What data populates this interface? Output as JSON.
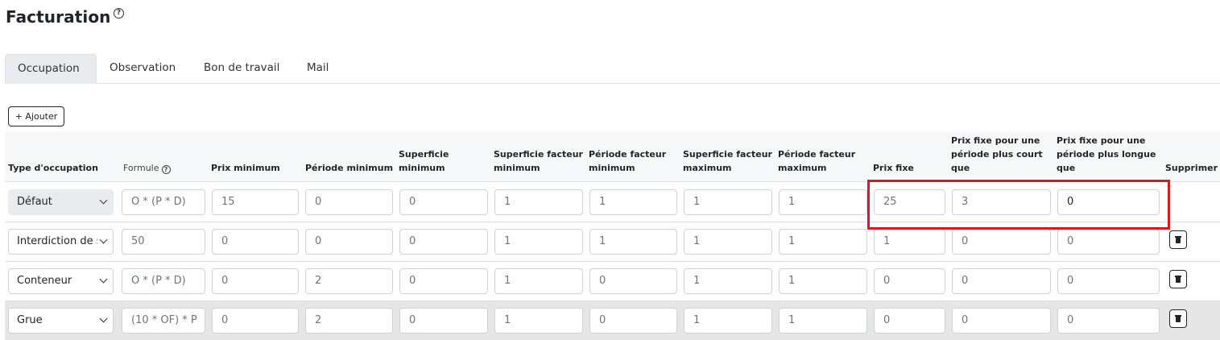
{
  "page": {
    "title": "Facturation",
    "help_glyph": "?"
  },
  "tabs": [
    {
      "label": "Occupation",
      "active": true
    },
    {
      "label": "Observation",
      "active": false
    },
    {
      "label": "Bon de travail",
      "active": false
    },
    {
      "label": "Mail",
      "active": false
    }
  ],
  "toolbar": {
    "add_label": "+ Ajouter"
  },
  "table": {
    "headers": {
      "type": "Type d'occupation",
      "formule": "Formule",
      "prix_min": "Prix minimum",
      "periode_min": "Période minimum",
      "superficie_min_l1": "Superficie",
      "superficie_min_l2": "minimum",
      "sup_fact_min_l1": "Superficie facteur",
      "sup_fact_min_l2": "minimum",
      "per_fact_min_l1": "Période facteur",
      "per_fact_min_l2": "minimum",
      "sup_fact_max_l1": "Superficie facteur",
      "sup_fact_max_l2": "maximum",
      "per_fact_max_l1": "Période facteur",
      "per_fact_max_l2": "maximum",
      "prix_fixe": "Prix fixe",
      "court_l1": "Prix fixe pour une",
      "court_l2": "période plus court",
      "court_l3": "que",
      "long_l1": "Prix fixe pour une",
      "long_l2": "période plus longue",
      "long_l3": "que",
      "supprimer": "Supprimer"
    },
    "rows": [
      {
        "type": "Défaut",
        "formule": "O * (P  * D)",
        "prix_min": "15",
        "periode_min": "0",
        "superficie_min": "0",
        "sup_fact_min": "1",
        "per_fact_min": "1",
        "sup_fact_max": "1",
        "per_fact_max": "1",
        "prix_fixe": "25",
        "court": "3",
        "long": "0"
      },
      {
        "type": "Interdiction de stationner",
        "formule": "50",
        "prix_min": "0",
        "periode_min": "0",
        "superficie_min": "0",
        "sup_fact_min": "1",
        "per_fact_min": "1",
        "sup_fact_max": "1",
        "per_fact_max": "1",
        "prix_fixe": "1",
        "court": "0",
        "long": "0"
      },
      {
        "type": "Conteneur",
        "formule": "O * (P  * D)",
        "prix_min": "0",
        "periode_min": "2",
        "superficie_min": "0",
        "sup_fact_min": "1",
        "per_fact_min": "0",
        "sup_fact_max": "1",
        "per_fact_max": "1",
        "prix_fixe": "0",
        "court": "0",
        "long": "0"
      },
      {
        "type": "Grue",
        "formule": "(10 * OF) * P",
        "prix_min": "0",
        "periode_min": "2",
        "superficie_min": "0",
        "sup_fact_min": "1",
        "per_fact_min": "0",
        "sup_fact_max": "1",
        "per_fact_max": "1",
        "prix_fixe": "0",
        "court": "0",
        "long": "0"
      }
    ]
  },
  "colors": {
    "highlight": "#e0161d",
    "active_tab": "#e9ecef",
    "hovered_row": "#e6e6e6"
  }
}
